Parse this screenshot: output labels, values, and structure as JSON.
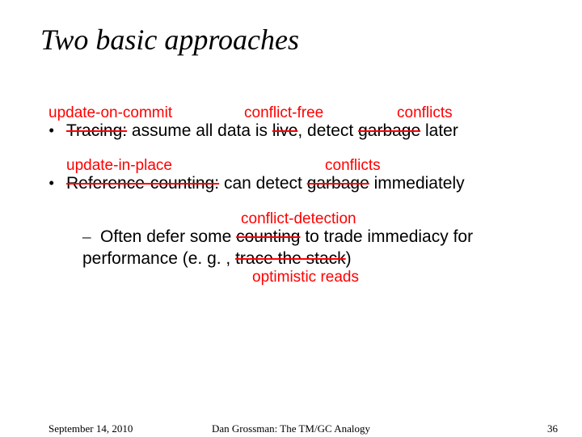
{
  "title": "Two basic approaches",
  "bullets": {
    "b1": {
      "mark": "•",
      "pre": "",
      "s1": "Tracing:",
      "mid1": " assume all data is ",
      "s2": "live",
      "mid2": ", detect ",
      "s3": "garbage",
      "post": " later"
    },
    "b2": {
      "mark": "•",
      "s1": "Reference-counting:",
      "mid1": " can detect ",
      "s2": "garbage",
      "post": " immediately"
    },
    "sub1": {
      "dash": "–",
      "pre": "Often defer some ",
      "s1": "counting",
      "mid1": " to trade immediacy for performance (e. g. , ",
      "s2": "trace the stack",
      "post": ")"
    }
  },
  "annotations": {
    "a1": "update-on-commit",
    "a2": "conflict-free",
    "a3": "conflicts",
    "a4": "update-in-place",
    "a5": "conflicts",
    "a6": "conflict-detection",
    "a7": "optimistic reads"
  },
  "footer": {
    "date": "September 14, 2010",
    "center": "Dan Grossman: The TM/GC Analogy",
    "page": "36"
  }
}
